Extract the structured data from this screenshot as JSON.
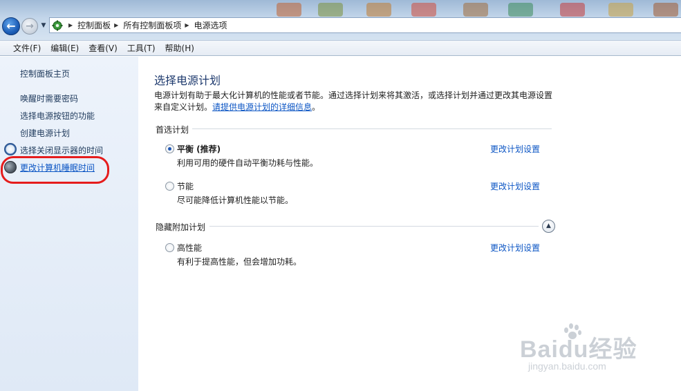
{
  "address_bar": {
    "breadcrumbs": [
      "控制面板",
      "所有控制面板项",
      "电源选项"
    ]
  },
  "menubar": {
    "items": [
      "文件(F)",
      "编辑(E)",
      "查看(V)",
      "工具(T)",
      "帮助(H)"
    ]
  },
  "sidebar": {
    "home": "控制面板主页",
    "items": [
      {
        "label": "唤醒时需要密码"
      },
      {
        "label": "选择电源按钮的功能"
      },
      {
        "label": "创建电源计划"
      },
      {
        "label": "选择关闭显示器的时间"
      },
      {
        "label": "更改计算机睡眠时间"
      }
    ]
  },
  "main": {
    "title": "选择电源计划",
    "description_text": "电源计划有助于最大化计算机的性能或者节能。通过选择计划来将其激活，或选择计划并通过更改其电源设置来自定义计划。",
    "description_link": "请提供电源计划的详细信息",
    "description_end": "。",
    "preferred_header": "首选计划",
    "hidden_header": "隐藏附加计划",
    "change_link": "更改计划设置",
    "plans": [
      {
        "name": "平衡 (推荐)",
        "desc": "利用可用的硬件自动平衡功耗与性能。",
        "selected": true
      },
      {
        "name": "节能",
        "desc": "尽可能降低计算机性能以节能。",
        "selected": false
      },
      {
        "name": "高性能",
        "desc": "有利于提高性能，但会增加功耗。",
        "selected": false
      }
    ]
  },
  "watermark": {
    "main": "Baidu经验",
    "sub": "jingyan.baidu.com"
  },
  "colors": {
    "link": "#0b55c4",
    "title": "#1e3a6e",
    "annotation": "#e51c1c"
  }
}
